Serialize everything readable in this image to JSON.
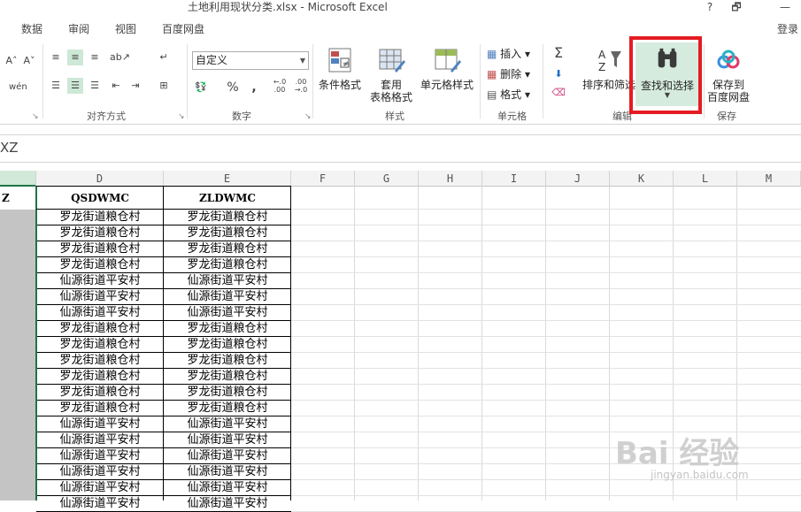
{
  "window": {
    "title": "土地利用现状分类.xlsx - Microsoft Excel",
    "help": "?",
    "restore": "🗗",
    "minimize": "—"
  },
  "tabs": [
    "数据",
    "审阅",
    "视图",
    "百度网盘"
  ],
  "signin": "登录",
  "ribbon": {
    "number_format": "自定义",
    "groups": {
      "alignment": "对齐方式",
      "number": "数字",
      "styles": "样式",
      "cells": "单元格",
      "editing": "编辑",
      "save": "保存"
    },
    "buttons": {
      "conditional": "条件格式",
      "table_format_1": "套用",
      "table_format_2": "表格格式",
      "cell_styles": "单元格样式",
      "insert": "插入",
      "delete": "删除",
      "format": "格式",
      "sort_filter": "排序和筛选",
      "find_select": "查找和选择",
      "save_baidu_1": "保存到",
      "save_baidu_2": "百度网盘"
    },
    "symbols": {
      "percent": "%",
      "comma": ",",
      "dec_inc": "←.0\n.00",
      "dec_dec": ".00\n→.0"
    }
  },
  "formula_bar": {
    "value": "XZ"
  },
  "columns": [
    "D",
    "E",
    "F",
    "G",
    "H",
    "I",
    "J",
    "K",
    "L",
    "M"
  ],
  "cell_c_header": "Z",
  "table": {
    "headers": [
      "QSDWMC",
      "ZLDWMC"
    ],
    "rows": [
      [
        "罗龙街道粮仓村",
        "罗龙街道粮仓村"
      ],
      [
        "罗龙街道粮仓村",
        "罗龙街道粮仓村"
      ],
      [
        "罗龙街道粮仓村",
        "罗龙街道粮仓村"
      ],
      [
        "罗龙街道粮仓村",
        "罗龙街道粮仓村"
      ],
      [
        "仙源街道平安村",
        "仙源街道平安村"
      ],
      [
        "仙源街道平安村",
        "仙源街道平安村"
      ],
      [
        "仙源街道平安村",
        "仙源街道平安村"
      ],
      [
        "罗龙街道粮仓村",
        "罗龙街道粮仓村"
      ],
      [
        "罗龙街道粮仓村",
        "罗龙街道粮仓村"
      ],
      [
        "罗龙街道粮仓村",
        "罗龙街道粮仓村"
      ],
      [
        "罗龙街道粮仓村",
        "罗龙街道粮仓村"
      ],
      [
        "罗龙街道粮仓村",
        "罗龙街道粮仓村"
      ],
      [
        "罗龙街道粮仓村",
        "罗龙街道粮仓村"
      ],
      [
        "仙源街道平安村",
        "仙源街道平安村"
      ],
      [
        "仙源街道平安村",
        "仙源街道平安村"
      ],
      [
        "仙源街道平安村",
        "仙源街道平安村"
      ],
      [
        "仙源街道平安村",
        "仙源街道平安村"
      ],
      [
        "仙源街道平安村",
        "仙源街道平安村"
      ],
      [
        "仙源街道平安村",
        "仙源街道平安村"
      ]
    ]
  },
  "watermark": {
    "text": "Bai 经验",
    "url": "jingyan.baidu.com"
  },
  "colors": {
    "accent": "#217346",
    "highlight": "#e51b23",
    "selected": "#d5ebde"
  }
}
